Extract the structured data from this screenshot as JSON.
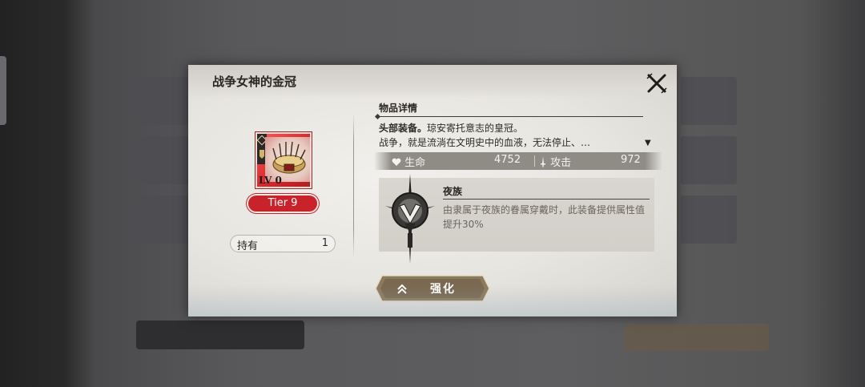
{
  "dialog": {
    "title": "战争女神的金冠",
    "close_icon": "close-x-icon"
  },
  "item": {
    "level_text": "LV 0",
    "tier_label": "Tier 9",
    "rarity_color": "#d9262b",
    "own_label": "持有",
    "own_count": "1"
  },
  "details": {
    "section_title": "物品详情",
    "desc_strong": "头部装备。",
    "desc_rest": "琼安寄托意志的皇冠。",
    "desc_line2": "战争，就是流淌在文明史中的血液，无法停止、…",
    "expand_icon": "triangle-down-icon"
  },
  "stats": [
    {
      "icon": "heart-icon",
      "label": "生命",
      "value": "4752"
    },
    {
      "icon": "sword-icon",
      "label": "攻击",
      "value": "972"
    }
  ],
  "faction": {
    "icon": "night-clan-emblem-icon",
    "name": "夜族",
    "desc": "由隶属于夜族的眷属穿戴时，此装备提供属性值提升30%"
  },
  "enhance": {
    "label": "强化",
    "icon": "double-chevron-up-icon"
  }
}
